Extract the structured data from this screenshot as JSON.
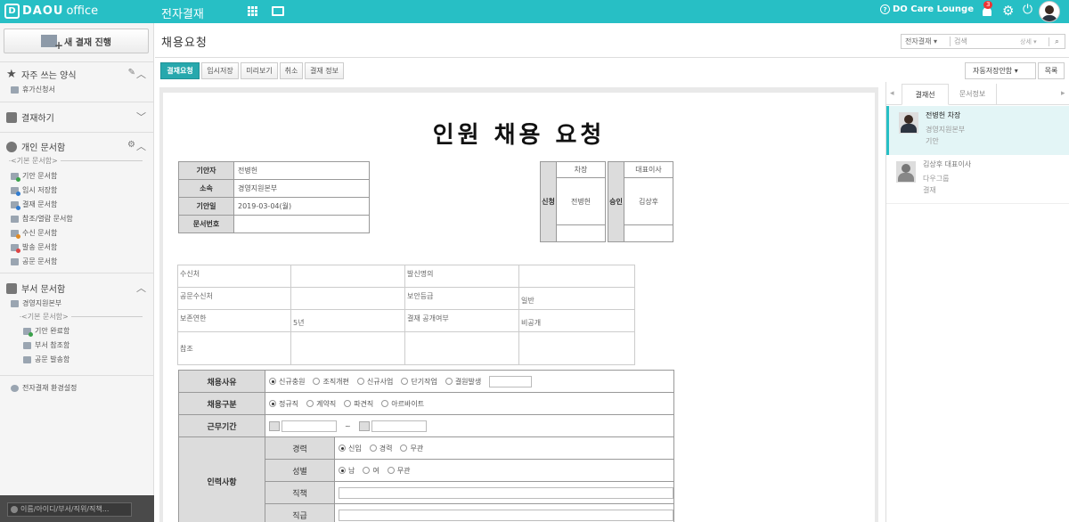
{
  "topbar": {
    "logo_brand": "DAOU",
    "logo_product": "office",
    "app_title": "전자결재",
    "care_label": "DO Care Lounge",
    "notification_count": "3"
  },
  "sidebar": {
    "new_approval": "새 결재 진행",
    "favorites": {
      "title": "자주 쓰는 양식",
      "items": [
        "휴가신청서"
      ]
    },
    "approve": {
      "title": "결재하기"
    },
    "personal": {
      "title": "개인 문서함",
      "subtitle": "<기본 문서함>",
      "items": [
        "기안 문서함",
        "임시 저장함",
        "결재 문서함",
        "참조/열람 문서함",
        "수신 문서함",
        "발송 문서함",
        "공문 문서함"
      ]
    },
    "dept": {
      "title": "부서 문서함",
      "dept_name": "경영지원본부",
      "subtitle": "<기본 문서함>",
      "items": [
        "기안 완료함",
        "부서 참조함",
        "공문 발송함"
      ]
    },
    "settings": "전자결재 환경설정",
    "bottom_search_placeholder": "이름/아이디/부서/직위/직책..."
  },
  "header": {
    "page_title": "채용요청",
    "search_scope": "전자결재",
    "search_placeholder": "검색",
    "search_detail": "상세"
  },
  "toolbar": {
    "buttons": [
      "결재요청",
      "임시저장",
      "미리보기",
      "취소",
      "결재 정보"
    ],
    "auto_save": "자동저장안함",
    "list": "목록"
  },
  "document": {
    "title": "인원 채용 요청",
    "info": [
      {
        "label": "기안자",
        "value": "전병헌"
      },
      {
        "label": "소속",
        "value": "경영지원본부"
      },
      {
        "label": "기안일",
        "value": "2019-03-04(월)"
      },
      {
        "label": "문서번호",
        "value": ""
      }
    ],
    "apply": {
      "side": "신청",
      "title": "차장",
      "name": "전병헌"
    },
    "approve": {
      "side": "승인",
      "title": "대표이사",
      "name": "김상후"
    },
    "meta": {
      "receiver": "수신처",
      "sender": "발신명의",
      "official_receiver": "공문수신처",
      "security": "보안등급",
      "security_value": "일반",
      "retention": "보존연한",
      "retention_value": "5년",
      "disclosure": "결재 공개여부",
      "disclosure_value": "비공개",
      "reference": "참조"
    },
    "form": {
      "reason_label": "채용사유",
      "reasons": [
        "신규충원",
        "조직개편",
        "신규사업",
        "단기작업",
        "결원발생"
      ],
      "type_label": "채용구분",
      "types": [
        "정규직",
        "계약직",
        "파견직",
        "아르바이트"
      ],
      "period_label": "근무기간",
      "period_sep": "~",
      "req_label": "인력사항",
      "career_label": "경력",
      "careers": [
        "신입",
        "경력",
        "무관"
      ],
      "gender_label": "성별",
      "genders": [
        "남",
        "여",
        "무관"
      ],
      "duty_label": "직책",
      "rank_label": "직급"
    }
  },
  "rightpanel": {
    "tabs": [
      "결재선",
      "문서정보"
    ],
    "lines": [
      {
        "name": "전병헌 차장",
        "dept": "경영지원본부",
        "status": "기안"
      },
      {
        "name": "김상후 대표이사",
        "dept": "다우그룹",
        "status": "결재"
      }
    ]
  }
}
